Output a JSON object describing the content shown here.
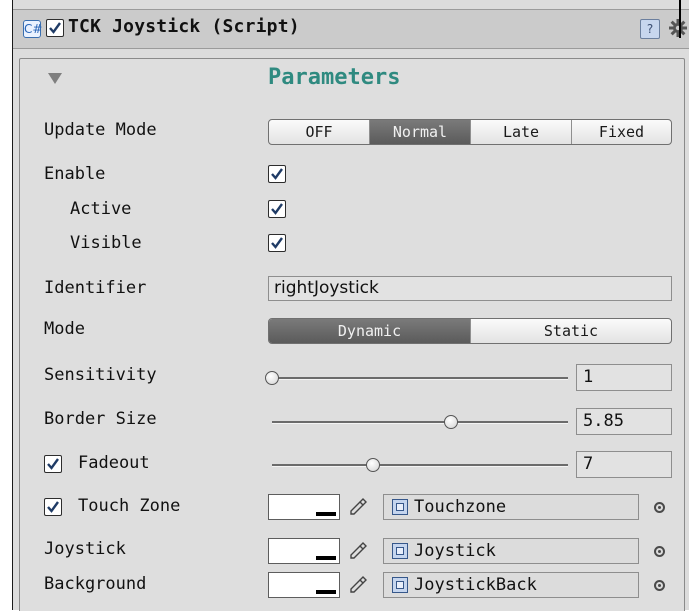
{
  "header": {
    "title": "TCK Joystick (Script)",
    "enabled": true,
    "script_icon": "C#",
    "help_icon": "?"
  },
  "section": {
    "title": "Parameters"
  },
  "update_mode": {
    "label": "Update Mode",
    "options": [
      "OFF",
      "Normal",
      "Late",
      "Fixed"
    ],
    "selected": "Normal"
  },
  "enable": {
    "label": "Enable",
    "checked": true
  },
  "active": {
    "label": "Active",
    "checked": true
  },
  "visible": {
    "label": "Visible",
    "checked": true
  },
  "identifier": {
    "label": "Identifier",
    "value": "rightJoystick"
  },
  "mode": {
    "label": "Mode",
    "options": [
      "Dynamic",
      "Static"
    ],
    "selected": "Dynamic"
  },
  "sensitivity": {
    "label": "Sensitivity",
    "value": "1",
    "level": 0.0
  },
  "border_size": {
    "label": "Border Size",
    "value": "5.85",
    "level": 0.6
  },
  "fadeout": {
    "label": "Fadeout",
    "checked": true,
    "value": "7",
    "level": 0.35
  },
  "touch_zone": {
    "label": "Touch Zone",
    "checked": true,
    "color": "#ffffff",
    "object": "Touchzone"
  },
  "joystick": {
    "label": "Joystick",
    "color": "#ffffff",
    "object": "Joystick"
  },
  "background": {
    "label": "Background",
    "color": "#ffffff",
    "object": "JoystickBack"
  },
  "colors": {
    "accent": "#2f8a80",
    "panel": "#dedede",
    "selected_segment": "#6a6a6a"
  }
}
